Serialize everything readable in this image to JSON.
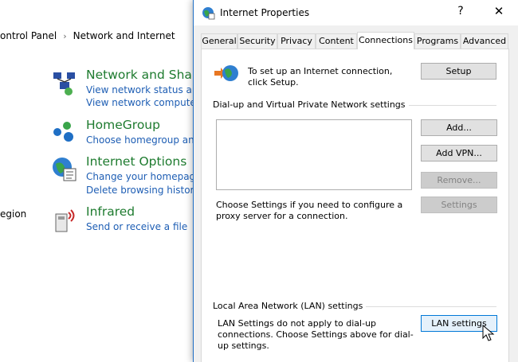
{
  "control_panel": {
    "breadcrumb": [
      "ontrol Panel",
      "Network and Internet"
    ],
    "left_text": "egion",
    "categories": [
      {
        "title": "Network and Sharin",
        "links": [
          "View network status and t",
          "View network computers"
        ]
      },
      {
        "title": "HomeGroup",
        "links": [
          "Choose homegroup and s"
        ]
      },
      {
        "title": "Internet Options",
        "links": [
          "Change your homepage",
          "Delete browsing history a"
        ]
      },
      {
        "title": "Infrared",
        "links": [
          "Send or receive a file"
        ]
      }
    ]
  },
  "dialog": {
    "title": "Internet Properties",
    "help_label": "?",
    "close_label": "✕",
    "tabs": [
      "General",
      "Security",
      "Privacy",
      "Content",
      "Connections",
      "Programs",
      "Advanced"
    ],
    "active_tab": "Connections",
    "setup_text": "To set up an Internet connection, click Setup.",
    "setup_button": "Setup",
    "dialup_group_label": "Dial-up and Virtual Private Network settings",
    "add_button": "Add...",
    "add_vpn_button": "Add VPN...",
    "remove_button": "Remove...",
    "settings_button": "Settings",
    "proxy_text": "Choose Settings if you need to configure a proxy server for a connection.",
    "lan_group_label": "Local Area Network (LAN) settings",
    "lan_text": "LAN Settings do not apply to dial-up connections. Choose Settings above for dial-up settings.",
    "lan_button": "LAN settings"
  },
  "colors": {
    "link_blue": "#1e5eb4",
    "category_green": "#1e7b2f",
    "accent_blue": "#0078d7"
  }
}
